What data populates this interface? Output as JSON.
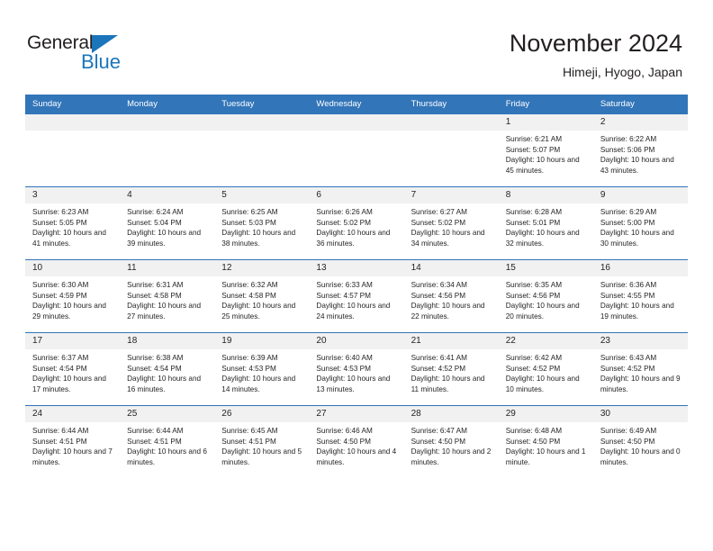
{
  "brand": {
    "name_part1": "General",
    "name_part2": "Blue",
    "accent_color": "#1b75bb"
  },
  "header": {
    "title": "November 2024",
    "subtitle": "Himeji, Hyogo, Japan"
  },
  "calendar": {
    "header_color": "#3275b9",
    "weekday_headers": [
      "Sunday",
      "Monday",
      "Tuesday",
      "Wednesday",
      "Thursday",
      "Friday",
      "Saturday"
    ],
    "weeks": [
      [
        {
          "day": "",
          "sunrise": "",
          "sunset": "",
          "daylight": "",
          "empty": true
        },
        {
          "day": "",
          "sunrise": "",
          "sunset": "",
          "daylight": "",
          "empty": true
        },
        {
          "day": "",
          "sunrise": "",
          "sunset": "",
          "daylight": "",
          "empty": true
        },
        {
          "day": "",
          "sunrise": "",
          "sunset": "",
          "daylight": "",
          "empty": true
        },
        {
          "day": "",
          "sunrise": "",
          "sunset": "",
          "daylight": "",
          "empty": true
        },
        {
          "day": "1",
          "sunrise": "Sunrise: 6:21 AM",
          "sunset": "Sunset: 5:07 PM",
          "daylight": "Daylight: 10 hours and 45 minutes."
        },
        {
          "day": "2",
          "sunrise": "Sunrise: 6:22 AM",
          "sunset": "Sunset: 5:06 PM",
          "daylight": "Daylight: 10 hours and 43 minutes."
        }
      ],
      [
        {
          "day": "3",
          "sunrise": "Sunrise: 6:23 AM",
          "sunset": "Sunset: 5:05 PM",
          "daylight": "Daylight: 10 hours and 41 minutes."
        },
        {
          "day": "4",
          "sunrise": "Sunrise: 6:24 AM",
          "sunset": "Sunset: 5:04 PM",
          "daylight": "Daylight: 10 hours and 39 minutes."
        },
        {
          "day": "5",
          "sunrise": "Sunrise: 6:25 AM",
          "sunset": "Sunset: 5:03 PM",
          "daylight": "Daylight: 10 hours and 38 minutes."
        },
        {
          "day": "6",
          "sunrise": "Sunrise: 6:26 AM",
          "sunset": "Sunset: 5:02 PM",
          "daylight": "Daylight: 10 hours and 36 minutes."
        },
        {
          "day": "7",
          "sunrise": "Sunrise: 6:27 AM",
          "sunset": "Sunset: 5:02 PM",
          "daylight": "Daylight: 10 hours and 34 minutes."
        },
        {
          "day": "8",
          "sunrise": "Sunrise: 6:28 AM",
          "sunset": "Sunset: 5:01 PM",
          "daylight": "Daylight: 10 hours and 32 minutes."
        },
        {
          "day": "9",
          "sunrise": "Sunrise: 6:29 AM",
          "sunset": "Sunset: 5:00 PM",
          "daylight": "Daylight: 10 hours and 30 minutes."
        }
      ],
      [
        {
          "day": "10",
          "sunrise": "Sunrise: 6:30 AM",
          "sunset": "Sunset: 4:59 PM",
          "daylight": "Daylight: 10 hours and 29 minutes."
        },
        {
          "day": "11",
          "sunrise": "Sunrise: 6:31 AM",
          "sunset": "Sunset: 4:58 PM",
          "daylight": "Daylight: 10 hours and 27 minutes."
        },
        {
          "day": "12",
          "sunrise": "Sunrise: 6:32 AM",
          "sunset": "Sunset: 4:58 PM",
          "daylight": "Daylight: 10 hours and 25 minutes."
        },
        {
          "day": "13",
          "sunrise": "Sunrise: 6:33 AM",
          "sunset": "Sunset: 4:57 PM",
          "daylight": "Daylight: 10 hours and 24 minutes."
        },
        {
          "day": "14",
          "sunrise": "Sunrise: 6:34 AM",
          "sunset": "Sunset: 4:56 PM",
          "daylight": "Daylight: 10 hours and 22 minutes."
        },
        {
          "day": "15",
          "sunrise": "Sunrise: 6:35 AM",
          "sunset": "Sunset: 4:56 PM",
          "daylight": "Daylight: 10 hours and 20 minutes."
        },
        {
          "day": "16",
          "sunrise": "Sunrise: 6:36 AM",
          "sunset": "Sunset: 4:55 PM",
          "daylight": "Daylight: 10 hours and 19 minutes."
        }
      ],
      [
        {
          "day": "17",
          "sunrise": "Sunrise: 6:37 AM",
          "sunset": "Sunset: 4:54 PM",
          "daylight": "Daylight: 10 hours and 17 minutes."
        },
        {
          "day": "18",
          "sunrise": "Sunrise: 6:38 AM",
          "sunset": "Sunset: 4:54 PM",
          "daylight": "Daylight: 10 hours and 16 minutes."
        },
        {
          "day": "19",
          "sunrise": "Sunrise: 6:39 AM",
          "sunset": "Sunset: 4:53 PM",
          "daylight": "Daylight: 10 hours and 14 minutes."
        },
        {
          "day": "20",
          "sunrise": "Sunrise: 6:40 AM",
          "sunset": "Sunset: 4:53 PM",
          "daylight": "Daylight: 10 hours and 13 minutes."
        },
        {
          "day": "21",
          "sunrise": "Sunrise: 6:41 AM",
          "sunset": "Sunset: 4:52 PM",
          "daylight": "Daylight: 10 hours and 11 minutes."
        },
        {
          "day": "22",
          "sunrise": "Sunrise: 6:42 AM",
          "sunset": "Sunset: 4:52 PM",
          "daylight": "Daylight: 10 hours and 10 minutes."
        },
        {
          "day": "23",
          "sunrise": "Sunrise: 6:43 AM",
          "sunset": "Sunset: 4:52 PM",
          "daylight": "Daylight: 10 hours and 9 minutes."
        }
      ],
      [
        {
          "day": "24",
          "sunrise": "Sunrise: 6:44 AM",
          "sunset": "Sunset: 4:51 PM",
          "daylight": "Daylight: 10 hours and 7 minutes."
        },
        {
          "day": "25",
          "sunrise": "Sunrise: 6:44 AM",
          "sunset": "Sunset: 4:51 PM",
          "daylight": "Daylight: 10 hours and 6 minutes."
        },
        {
          "day": "26",
          "sunrise": "Sunrise: 6:45 AM",
          "sunset": "Sunset: 4:51 PM",
          "daylight": "Daylight: 10 hours and 5 minutes."
        },
        {
          "day": "27",
          "sunrise": "Sunrise: 6:46 AM",
          "sunset": "Sunset: 4:50 PM",
          "daylight": "Daylight: 10 hours and 4 minutes."
        },
        {
          "day": "28",
          "sunrise": "Sunrise: 6:47 AM",
          "sunset": "Sunset: 4:50 PM",
          "daylight": "Daylight: 10 hours and 2 minutes."
        },
        {
          "day": "29",
          "sunrise": "Sunrise: 6:48 AM",
          "sunset": "Sunset: 4:50 PM",
          "daylight": "Daylight: 10 hours and 1 minute."
        },
        {
          "day": "30",
          "sunrise": "Sunrise: 6:49 AM",
          "sunset": "Sunset: 4:50 PM",
          "daylight": "Daylight: 10 hours and 0 minutes."
        }
      ]
    ]
  }
}
